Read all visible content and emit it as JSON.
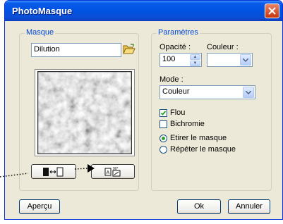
{
  "window": {
    "title": "PhotoMasque"
  },
  "masque": {
    "legend": "Masque",
    "file_value": "Dilution"
  },
  "parametres": {
    "legend": "Paramètres",
    "opacite_label": "Opacité :",
    "opacite_value": "100",
    "couleur_label": "Couleur :",
    "couleur_value": "",
    "mode_label": "Mode :",
    "mode_value": "Couleur",
    "flou_label": "Flou",
    "flou_checked": true,
    "bichromie_label": "Bichromie",
    "bichromie_checked": false,
    "etirer_label": "Etirer le masque",
    "repeter_label": "Répéter le masque",
    "selected_option": "etirer"
  },
  "buttons": {
    "apercu": "Aperçu",
    "ok": "Ok",
    "annuler": "Annuler"
  },
  "colors": {
    "accent": "#0046d5",
    "titlebar": "#0054e3",
    "face": "#ece9d8",
    "check_green": "#2ea034"
  },
  "icons": [
    "close-icon",
    "folder-open-icon",
    "flip-icon",
    "rotate-icon",
    "spin-up-icon",
    "spin-down-icon",
    "chevron-down-icon"
  ]
}
